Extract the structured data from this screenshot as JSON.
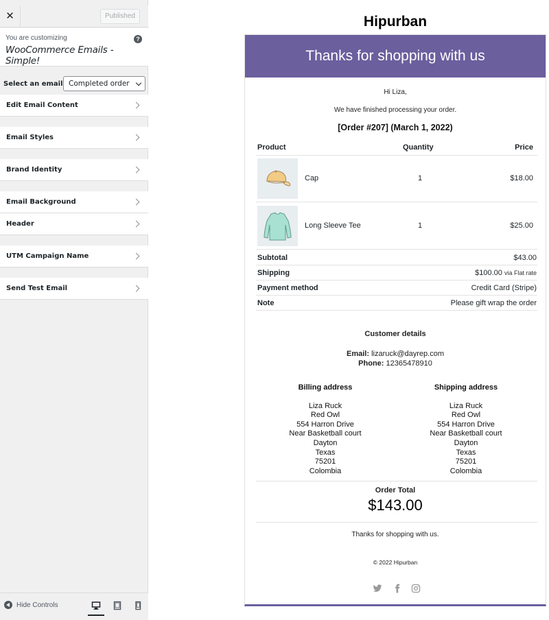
{
  "customizer": {
    "close_label": "✕",
    "publish_label": "Published",
    "you_are_customizing": "You are customizing",
    "panel_title": "WooCommerce Emails - Simple!",
    "help_label": "?",
    "select_email_label": "Select an email",
    "select_email_value": "Completed order",
    "sections": [
      {
        "label": "Edit Email Content"
      },
      {
        "label": "Email Styles"
      },
      {
        "label": "Brand Identity"
      },
      {
        "label": "Email Background"
      },
      {
        "label": "Header"
      },
      {
        "label": "UTM Campaign Name"
      },
      {
        "label": "Send Test Email"
      }
    ],
    "hide_controls_label": "Hide Controls",
    "devices": [
      "desktop-icon",
      "tablet-icon",
      "mobile-icon"
    ],
    "active_device": "desktop"
  },
  "preview": {
    "site_title": "Hipurban",
    "header_text": "Thanks for shopping with us",
    "header_color": "#6b5f9e",
    "greeting": "Hi Liza,",
    "intro": "We have finished processing your order.",
    "order_title": "[Order #207] (March 1, 2022)",
    "columns": {
      "product": "Product",
      "quantity": "Quantity",
      "price": "Price"
    },
    "items": [
      {
        "name": "Cap",
        "quantity": "1",
        "price": "$18.00",
        "icon": "cap-image"
      },
      {
        "name": "Long Sleeve Tee",
        "quantity": "1",
        "price": "$25.00",
        "icon": "long-sleeve-tee-image"
      }
    ],
    "totals": {
      "subtotal_label": "Subtotal",
      "subtotal_value": "$43.00",
      "shipping_label": "Shipping",
      "shipping_value": "$100.00",
      "shipping_via": "via Flat rate",
      "payment_label": "Payment method",
      "payment_value": "Credit Card (Stripe)",
      "note_label": "Note",
      "note_value": "Please gift wrap the order"
    },
    "customer": {
      "heading": "Customer details",
      "email_label": "Email:",
      "email_value": "lizaruck@dayrep.com",
      "phone_label": "Phone:",
      "phone_value": "12365478910"
    },
    "billing": {
      "heading": "Billing address",
      "lines": [
        "Liza Ruck",
        "Red Owl",
        "554 Harron Drive",
        "Near Basketball court",
        "Dayton",
        "Texas",
        "75201",
        "Colombia"
      ]
    },
    "shipping": {
      "heading": "Shipping address",
      "lines": [
        "Liza Ruck",
        "Red Owl",
        "554 Harron Drive",
        "Near Basketball court",
        "Dayton",
        "Texas",
        "75201",
        "Colombia"
      ]
    },
    "order_total_label": "Order Total",
    "order_total_value": "$143.00",
    "footer_text": "Thanks for shopping with us.",
    "copyright": "© 2022 Hipurban",
    "social": [
      "twitter-icon",
      "facebook-icon",
      "instagram-icon"
    ]
  }
}
